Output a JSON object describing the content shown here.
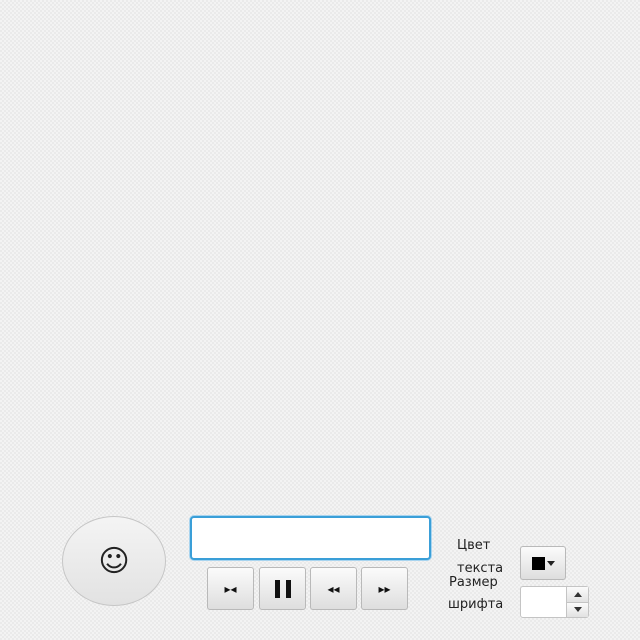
{
  "emoji_button": {
    "glyph": "☺",
    "icon": "smiley-icon"
  },
  "text_input": {
    "value": "",
    "placeholder": ""
  },
  "controls": [
    {
      "name": "step-back-button",
      "glyph": "▸◂",
      "icon": "jump-start-icon"
    },
    {
      "name": "pause-button",
      "icon": "pause-icon"
    },
    {
      "name": "rewind-button",
      "glyph": "◂◂",
      "icon": "rewind-icon"
    },
    {
      "name": "fast-forward-button",
      "glyph": "▸▸",
      "icon": "fast-forward-icon"
    }
  ],
  "text_color": {
    "label_line1": "Цвет",
    "label_line2": "текста",
    "value": "#000000"
  },
  "font_size": {
    "label_line1": "Размер",
    "label_line2": "шрифта",
    "value": ""
  },
  "colors": {
    "accent": "#3a9fd8",
    "swatch": "#000000"
  }
}
